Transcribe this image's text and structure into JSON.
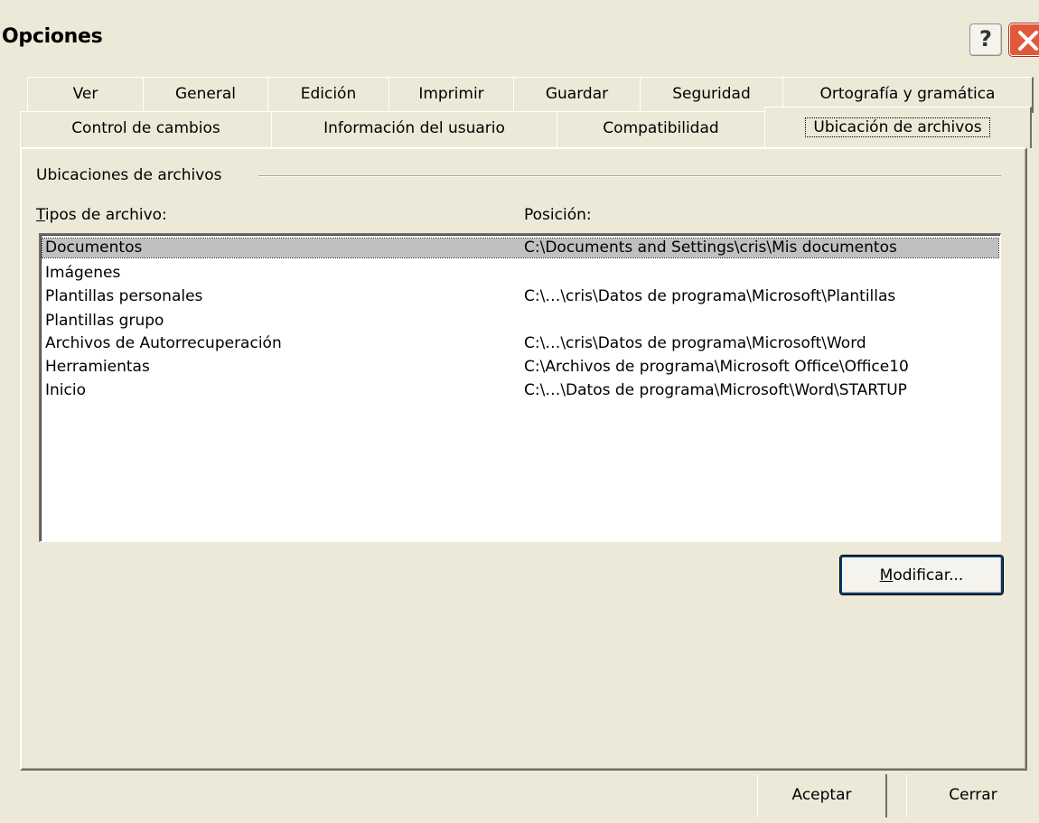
{
  "window": {
    "title": "Opciones"
  },
  "tabs_row1": [
    {
      "label": "Ver"
    },
    {
      "label": "General"
    },
    {
      "label": "Edición"
    },
    {
      "label": "Imprimir"
    },
    {
      "label": "Guardar"
    },
    {
      "label": "Seguridad"
    },
    {
      "label": "Ortografía y gramática"
    }
  ],
  "tabs_row2": [
    {
      "label": "Control de cambios"
    },
    {
      "label": "Información del usuario"
    },
    {
      "label": "Compatibilidad"
    },
    {
      "label": "Ubicación de archivos",
      "selected": true
    }
  ],
  "panel": {
    "group_label": "Ubicaciones de archivos",
    "col_types_first": "T",
    "col_types_rest": "ipos de archivo:",
    "col_position": "Posición:",
    "rows": [
      {
        "type": "Documentos",
        "position": "C:\\Documents and Settings\\cris\\Mis documentos",
        "selected": true
      },
      {
        "type": "Imágenes",
        "position": ""
      },
      {
        "type": "Plantillas personales",
        "position": "C:\\…\\cris\\Datos de programa\\Microsoft\\Plantillas"
      },
      {
        "type": "Plantillas grupo",
        "position": ""
      },
      {
        "type": "Archivos de Autorrecuperación",
        "position": "C:\\…\\cris\\Datos de programa\\Microsoft\\Word"
      },
      {
        "type": "Herramientas",
        "position": "C:\\Archivos de programa\\Microsoft Office\\Office10"
      },
      {
        "type": "Inicio",
        "position": "C:\\…\\Datos de programa\\Microsoft\\Word\\STARTUP"
      }
    ],
    "modify_first": "M",
    "modify_rest": "odificar..."
  },
  "footer": {
    "ok_label": "Aceptar",
    "close_label": "Cerrar"
  },
  "titlebar_buttons": {
    "help": "?"
  }
}
